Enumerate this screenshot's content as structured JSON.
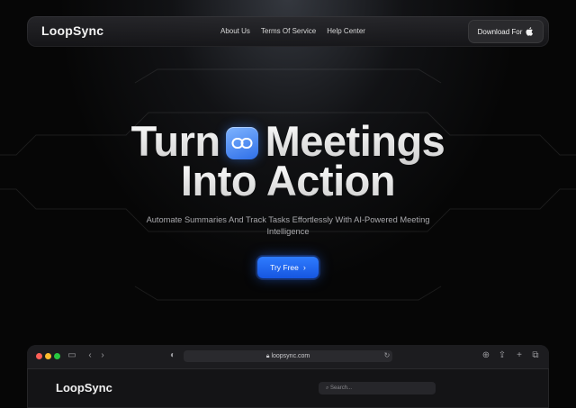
{
  "nav": {
    "logo": "LoopSync",
    "links": [
      "About Us",
      "Terms Of Service",
      "Help Center"
    ],
    "download_label": "Download For"
  },
  "hero": {
    "title_word1": "Turn",
    "title_word2": "Meetings",
    "title_line2": "Into Action",
    "subtitle": "Automate Summaries And Track Tasks Effortlessly With AI-Powered Meeting Intelligence",
    "cta_label": "Try Free"
  },
  "browser": {
    "url": "loopsync.com",
    "inner_logo": "LoopSync",
    "search_placeholder": "Search..."
  },
  "colors": {
    "background": "#060606",
    "accent": "#1f6cff",
    "badge": "#4a8cff"
  },
  "icons": [
    "apple-icon",
    "link-icon",
    "chevron-right-icon",
    "sidebar-icon",
    "back-icon",
    "forward-icon",
    "shield-icon",
    "lock-icon",
    "reload-icon",
    "download-icon",
    "share-icon",
    "plus-icon",
    "tabs-icon",
    "search-icon"
  ]
}
